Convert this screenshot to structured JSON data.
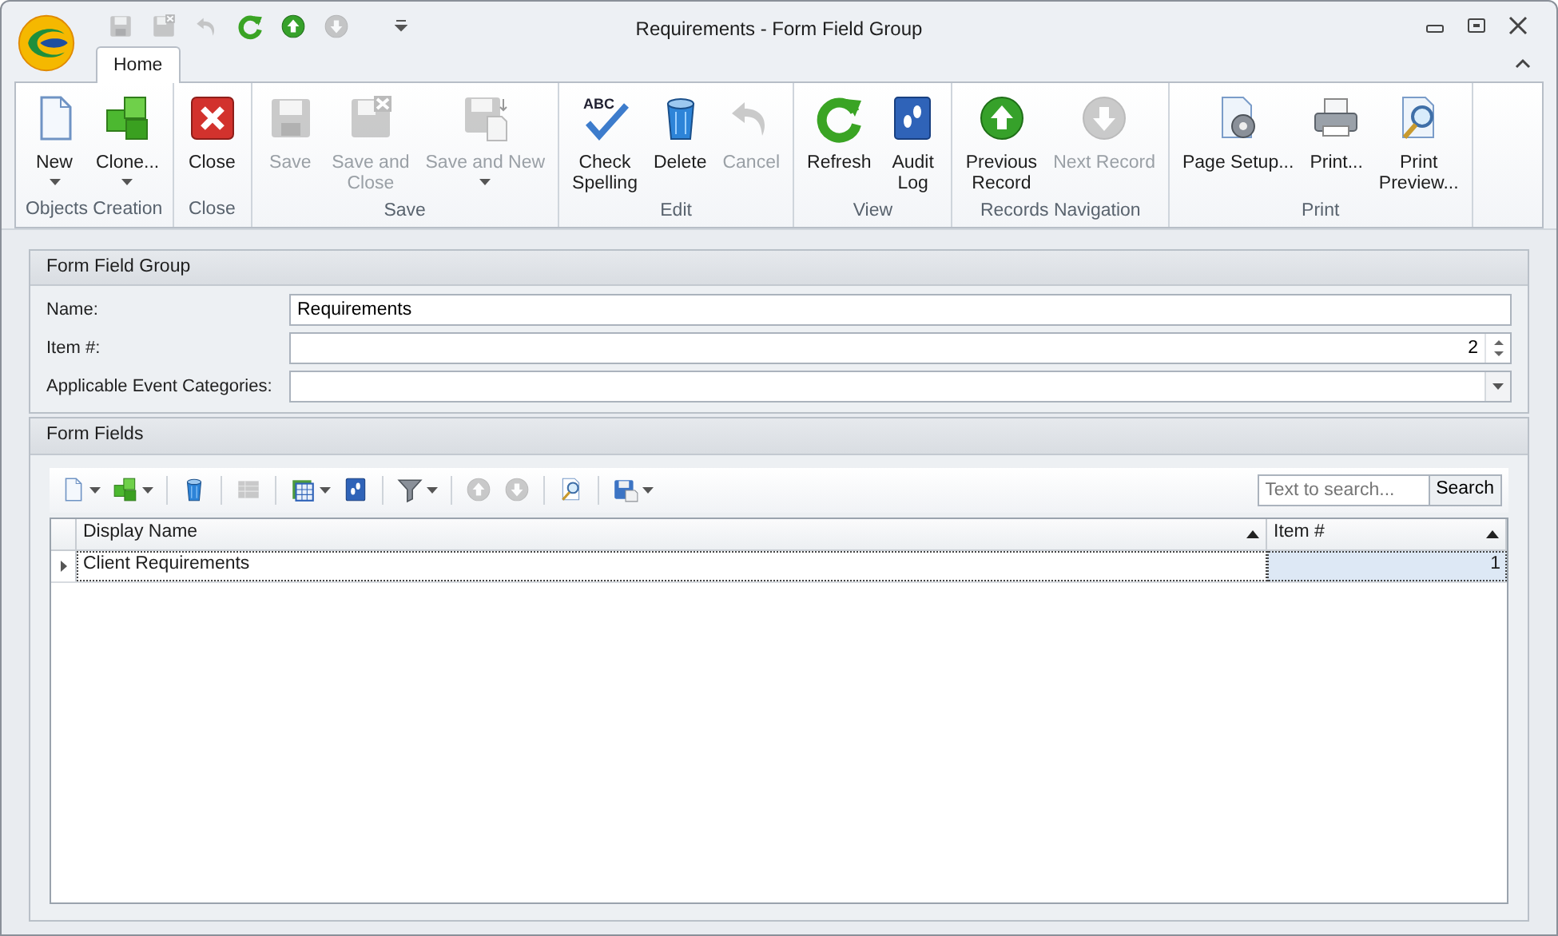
{
  "window": {
    "title": "Requirements - Form Field Group"
  },
  "quick_access": [
    {
      "kind": "save",
      "disabled": true
    },
    {
      "kind": "save-close",
      "disabled": true
    },
    {
      "kind": "undo",
      "disabled": true
    },
    {
      "kind": "refresh",
      "disabled": false
    },
    {
      "kind": "up",
      "disabled": false
    },
    {
      "kind": "down",
      "disabled": true
    }
  ],
  "tabs": [
    {
      "label": "Home",
      "selected": true
    }
  ],
  "ribbon": [
    {
      "label": "Objects Creation",
      "buttons": [
        {
          "label": "New",
          "kind": "new",
          "disabled": false,
          "dropdown": true
        },
        {
          "label": "Clone...",
          "kind": "clone",
          "disabled": false,
          "dropdown": true
        }
      ]
    },
    {
      "label": "Close",
      "buttons": [
        {
          "label": "Close",
          "kind": "close",
          "disabled": false,
          "dropdown": false
        }
      ]
    },
    {
      "label": "Save",
      "buttons": [
        {
          "label": "Save",
          "kind": "save",
          "disabled": true,
          "dropdown": false
        },
        {
          "label": "Save and\nClose",
          "kind": "save-close",
          "disabled": true,
          "dropdown": false
        },
        {
          "label": "Save and New",
          "kind": "save-new",
          "disabled": true,
          "dropdown": true
        }
      ]
    },
    {
      "label": "Edit",
      "buttons": [
        {
          "label": "Check\nSpelling",
          "kind": "spell",
          "icon_text": "ABC",
          "disabled": false,
          "dropdown": false
        },
        {
          "label": "Delete",
          "kind": "delete",
          "disabled": false,
          "dropdown": false
        },
        {
          "label": "Cancel",
          "kind": "undo",
          "disabled": true,
          "dropdown": false
        }
      ]
    },
    {
      "label": "View",
      "buttons": [
        {
          "label": "Refresh",
          "kind": "refresh",
          "disabled": false,
          "dropdown": false
        },
        {
          "label": "Audit\nLog",
          "kind": "audit",
          "disabled": false,
          "dropdown": false
        }
      ]
    },
    {
      "label": "Records Navigation",
      "buttons": [
        {
          "label": "Previous\nRecord",
          "kind": "up",
          "disabled": false,
          "dropdown": false
        },
        {
          "label": "Next Record",
          "kind": "down",
          "disabled": true,
          "dropdown": false
        }
      ]
    },
    {
      "label": "Print",
      "buttons": [
        {
          "label": "Page Setup...",
          "kind": "page-setup",
          "disabled": false,
          "dropdown": false
        },
        {
          "label": "Print...",
          "kind": "print",
          "disabled": false,
          "dropdown": false
        },
        {
          "label": "Print\nPreview...",
          "kind": "preview",
          "disabled": false,
          "dropdown": false
        }
      ]
    }
  ],
  "form_group": {
    "title": "Form Field Group",
    "fields": [
      {
        "label": "Name:",
        "value": "Requirements",
        "kind": "text"
      },
      {
        "label": "Item #:",
        "value": "2",
        "kind": "spin"
      },
      {
        "label": "Applicable Event Categories:",
        "kind": "combo"
      }
    ]
  },
  "form_fields": {
    "title": "Form Fields",
    "toolbar": [
      [
        {
          "kind": "new",
          "disabled": false,
          "dropdown": true
        },
        {
          "kind": "clone",
          "disabled": false,
          "dropdown": true
        }
      ],
      [
        {
          "kind": "delete",
          "disabled": false,
          "dropdown": false
        }
      ],
      [
        {
          "kind": "grid",
          "disabled": true,
          "dropdown": false
        }
      ],
      [
        {
          "kind": "columns",
          "disabled": false,
          "dropdown": true
        },
        {
          "kind": "audit",
          "disabled": false,
          "dropdown": false
        }
      ],
      [
        {
          "kind": "filter",
          "disabled": false,
          "dropdown": true
        }
      ],
      [
        {
          "kind": "up",
          "disabled": true,
          "dropdown": false
        },
        {
          "kind": "down",
          "disabled": true,
          "dropdown": false
        }
      ],
      [
        {
          "kind": "find",
          "disabled": false,
          "dropdown": false
        }
      ],
      [
        {
          "kind": "export",
          "disabled": false,
          "dropdown": true
        }
      ]
    ],
    "search": {
      "placeholder": "Text to search...",
      "button": "Search"
    },
    "columns": [
      "Display Name",
      "Item #"
    ],
    "rows": [
      {
        "cells": [
          "Client Requirements",
          "1"
        ],
        "selected": true
      }
    ]
  }
}
